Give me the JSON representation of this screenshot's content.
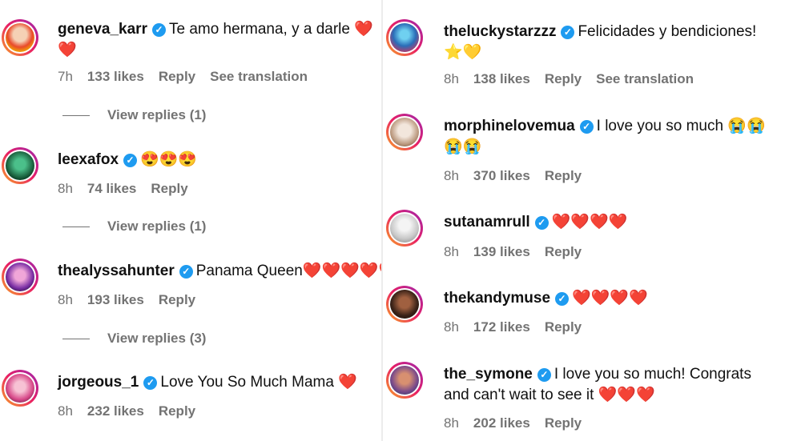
{
  "left_comments": [
    {
      "user": "geneva_karr",
      "text_line1": "Te amo hermana, y a darle ❤️",
      "text_line2": "❤️",
      "time": "7h",
      "likes": "133 likes",
      "reply": "Reply",
      "translate": "See translation",
      "view_replies": "View replies (1)"
    },
    {
      "user": "leexafox",
      "text_line1": "😍😍😍",
      "time": "8h",
      "likes": "74 likes",
      "reply": "Reply",
      "view_replies": "View replies (1)"
    },
    {
      "user": "thealyssahunter",
      "text_line1": "Panama Queen❤️❤️❤️❤️❤️",
      "time": "8h",
      "likes": "193 likes",
      "reply": "Reply",
      "view_replies": "View replies (3)"
    },
    {
      "user": "jorgeous_1",
      "text_line1": "Love You So Much Mama ❤️",
      "time": "8h",
      "likes": "232 likes",
      "reply": "Reply"
    }
  ],
  "right_comments": [
    {
      "user": "theluckystarzzz",
      "text_line1": "Felicidades y bendiciones!",
      "text_line2": "⭐💛",
      "time": "8h",
      "likes": "138 likes",
      "reply": "Reply",
      "translate": "See translation"
    },
    {
      "user": "morphinelovemua",
      "text_line1": "I love you so much 😭😭",
      "text_line2": "😭😭",
      "time": "8h",
      "likes": "370 likes",
      "reply": "Reply"
    },
    {
      "user": "sutanamrull",
      "text_line1": "❤️❤️❤️❤️",
      "time": "8h",
      "likes": "139 likes",
      "reply": "Reply"
    },
    {
      "user": "thekandymuse",
      "text_line1": "❤️❤️❤️❤️",
      "time": "8h",
      "likes": "172 likes",
      "reply": "Reply"
    },
    {
      "user": "the_symone",
      "text_line1": "I love you so much! Congrats",
      "text_line2": "and can't wait to see it ❤️❤️❤️",
      "time": "8h",
      "likes": "202 likes",
      "reply": "Reply"
    }
  ],
  "colors": {
    "verified": "#1e9bf0",
    "meta": "#737373",
    "heart": "#e0202a"
  },
  "icons": {
    "verified": "verified-badge-icon"
  }
}
